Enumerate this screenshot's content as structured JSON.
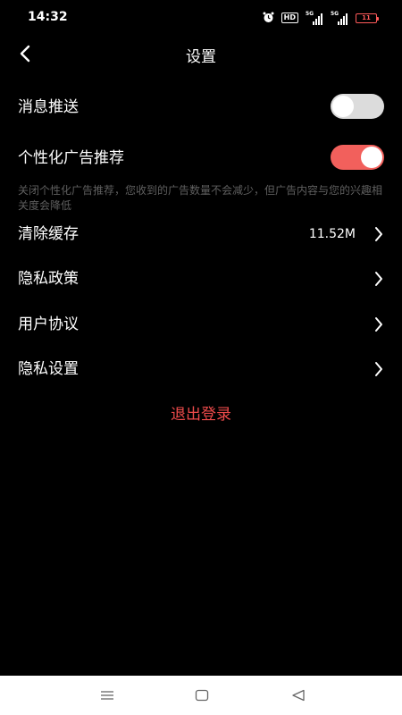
{
  "status_bar": {
    "time": "14:32",
    "hd_label": "HD",
    "signal1_label": "5G",
    "signal2_label": "5G",
    "battery_level": "11",
    "icons": [
      "alarm-icon",
      "hd-icon",
      "signal-icon",
      "signal-icon",
      "battery-icon"
    ]
  },
  "nav": {
    "back_icon": "chevron-left-icon",
    "title": "设置"
  },
  "settings": {
    "push": {
      "label": "消息推送",
      "enabled": false
    },
    "personalized_ads": {
      "label": "个性化广告推荐",
      "enabled": true,
      "hint": "关闭个性化广告推荐，您收到的广告数量不会减少，但广告内容与您的兴趣相关度会降低"
    },
    "clear_cache": {
      "label": "清除缓存",
      "value": "11.52M"
    },
    "privacy_policy": {
      "label": "隐私政策"
    },
    "user_agreement": {
      "label": "用户协议"
    },
    "privacy_settings": {
      "label": "隐私设置"
    }
  },
  "logout": {
    "label": "退出登录"
  },
  "colors": {
    "background": "#000000",
    "accent": "#f2605c",
    "logout": "#ee4b4b",
    "toggle_off": "#dcdcdc",
    "hint": "#5f5f5f"
  },
  "system_nav": {
    "icons": [
      "menu-icon",
      "home-icon",
      "back-triangle-icon"
    ]
  }
}
